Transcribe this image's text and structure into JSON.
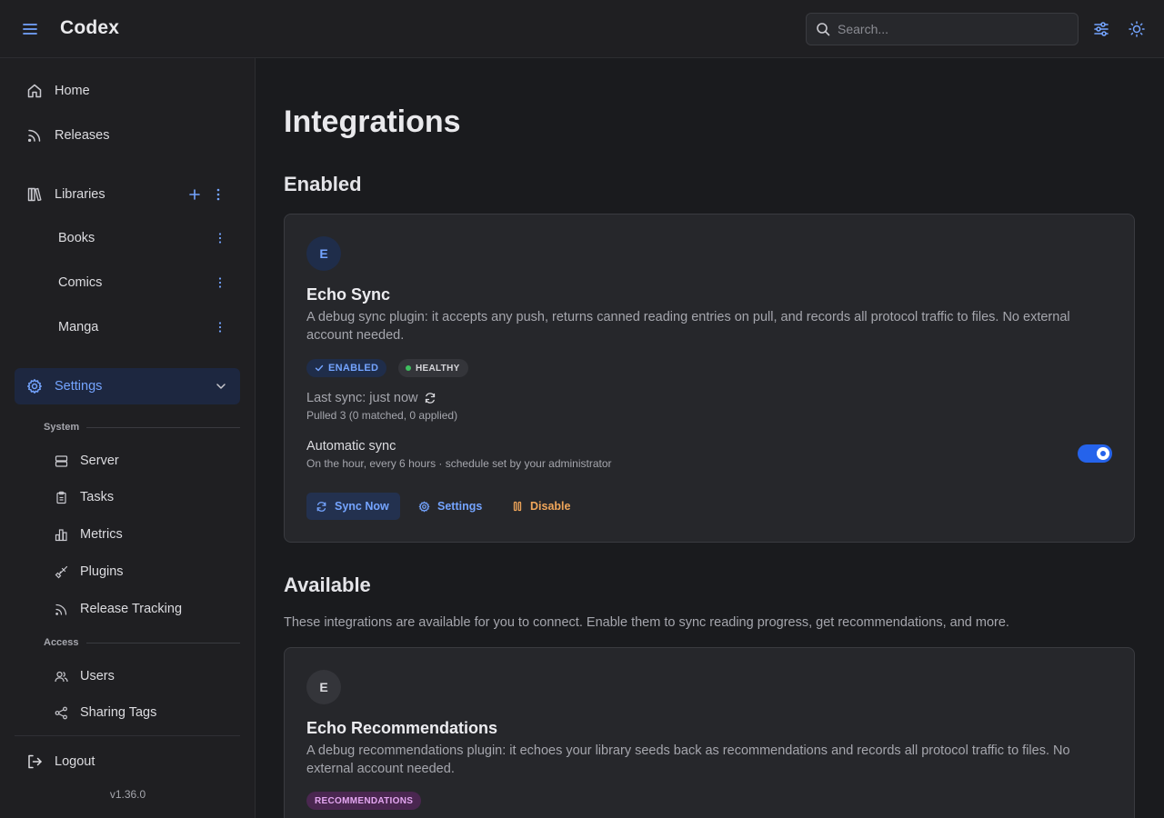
{
  "header": {
    "app_title": "Codex",
    "search_placeholder": "Search...",
    "icons": [
      "menu-icon",
      "search-icon",
      "sliders-icon",
      "sun-icon"
    ]
  },
  "sidebar": {
    "nav": [
      {
        "label": "Home",
        "icon": "home-icon"
      },
      {
        "label": "Releases",
        "icon": "rss-icon"
      }
    ],
    "libraries": {
      "label": "Libraries",
      "icon": "library-icon",
      "items": [
        {
          "label": "Books"
        },
        {
          "label": "Comics"
        },
        {
          "label": "Manga"
        }
      ]
    },
    "settings": {
      "label": "Settings",
      "icon": "gear-icon",
      "expanded": true,
      "system_label": "System",
      "system_items": [
        {
          "label": "Server",
          "icon": "server-icon"
        },
        {
          "label": "Tasks",
          "icon": "clipboard-icon"
        },
        {
          "label": "Metrics",
          "icon": "bar-chart-icon"
        },
        {
          "label": "Plugins",
          "icon": "plug-icon"
        },
        {
          "label": "Release Tracking",
          "icon": "rss-icon"
        }
      ],
      "access_label": "Access",
      "access_items": [
        {
          "label": "Users",
          "icon": "users-icon"
        },
        {
          "label": "Sharing Tags",
          "icon": "share-icon"
        }
      ]
    },
    "logout_label": "Logout",
    "version": "v1.36.0"
  },
  "main": {
    "title": "Integrations",
    "enabled_heading": "Enabled",
    "enabled_card": {
      "avatar_letter": "E",
      "title": "Echo Sync",
      "description": "A debug sync plugin: it accepts any push, returns canned reading entries on pull, and records all protocol traffic to files. No external account needed.",
      "badge_enabled": "ENABLED",
      "badge_healthy": "HEALTHY",
      "last_sync": "Last sync: just now",
      "pulled": "Pulled 3 (0 matched, 0 applied)",
      "auto_sync_label": "Automatic sync",
      "auto_sync_desc": "On the hour, every 6 hours · schedule set by your administrator",
      "auto_sync_on": true,
      "buttons": {
        "sync_now": "Sync Now",
        "settings": "Settings",
        "disable": "Disable"
      }
    },
    "available_heading": "Available",
    "available_desc": "These integrations are available for you to connect. Enable them to sync reading progress, get recommendations, and more.",
    "available_card": {
      "avatar_letter": "E",
      "title": "Echo Recommendations",
      "description": "A debug recommendations plugin: it echoes your library seeds back as recommendations and records all protocol traffic to files. No external account needed.",
      "badge": "RECOMMENDATIONS"
    }
  },
  "colors": {
    "accent": "#74a4ff",
    "toggle_on": "#2563eb",
    "disable": "#f0a65a",
    "recommend_badge_bg": "#4a2750",
    "recommend_badge_text": "#e3a6f0"
  }
}
